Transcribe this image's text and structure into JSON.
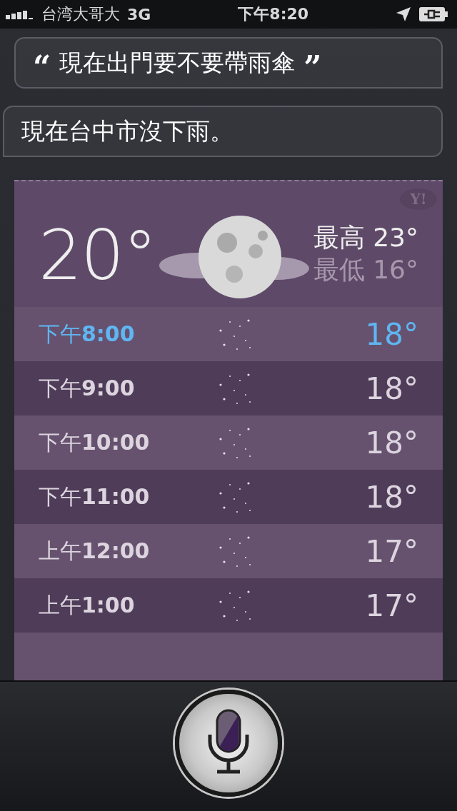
{
  "status_bar": {
    "carrier": "台湾大哥大",
    "network": "3G",
    "time": "下午8:20"
  },
  "conversation": [
    {
      "kind": "query",
      "open_quote": "“",
      "text": "現在出門要不要帶雨傘",
      "close_quote": "”"
    },
    {
      "kind": "answer",
      "text": "現在台中市沒下雨。"
    }
  ],
  "weather": {
    "logo": "Y!",
    "temperature": "20°",
    "high_label": "最高",
    "high": "23°",
    "low_label": "最低",
    "low": "16°",
    "hours": [
      {
        "time": "下午**8:00**",
        "temp": "18°",
        "selected": true
      },
      {
        "time": "下午**9:00**",
        "temp": "18°",
        "selected": false
      },
      {
        "time": "下午**10:00**",
        "temp": "18°",
        "selected": false
      },
      {
        "time": "下午**11:00**",
        "temp": "18°",
        "selected": false
      },
      {
        "time": "上午**12:00**",
        "temp": "17°",
        "selected": false
      },
      {
        "time": "上午**1:00**",
        "temp": "17°",
        "selected": false
      }
    ]
  }
}
